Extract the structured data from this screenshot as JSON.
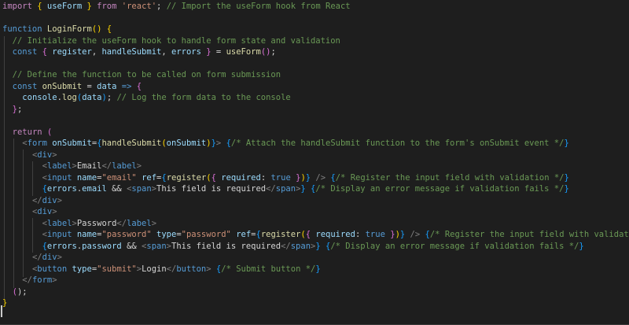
{
  "editor": {
    "colors": {
      "background": "#1e1e1e",
      "keyword": "#c586c0",
      "storage": "#569cd6",
      "variable": "#9cdcfe",
      "function": "#dcdcaa",
      "string": "#ce9178",
      "comment": "#6a9955",
      "tag": "#569cd6",
      "bracket_gold": "#ffd700",
      "bracket_pink": "#da70d6",
      "bracket_blue": "#179fff",
      "plain": "#d4d4d4"
    },
    "lines": [
      [
        [
          "import",
          "kw"
        ],
        [
          " ",
          "p"
        ],
        [
          "{",
          "y"
        ],
        [
          " useForm ",
          "v"
        ],
        [
          "}",
          "y"
        ],
        [
          " ",
          "p"
        ],
        [
          "from",
          "kw"
        ],
        [
          " ",
          "p"
        ],
        [
          "'react'",
          "s"
        ],
        [
          "; ",
          "p"
        ],
        [
          "// Import the useForm hook from React",
          "c"
        ]
      ],
      [],
      [
        [
          "function",
          "st"
        ],
        [
          " ",
          "p"
        ],
        [
          "LoginForm",
          "f"
        ],
        [
          "()",
          "y"
        ],
        [
          " ",
          "p"
        ],
        [
          "{",
          "y"
        ]
      ],
      [
        [
          "  ",
          "p"
        ],
        [
          "// Initialize the useForm hook to handle form state and validation",
          "c"
        ]
      ],
      [
        [
          "  ",
          "p"
        ],
        [
          "const",
          "st"
        ],
        [
          " ",
          "p"
        ],
        [
          "{",
          "pk"
        ],
        [
          " ",
          "p"
        ],
        [
          "register",
          "v"
        ],
        [
          ", ",
          "p"
        ],
        [
          "handleSubmit",
          "v"
        ],
        [
          ", ",
          "p"
        ],
        [
          "errors",
          "v"
        ],
        [
          " ",
          "p"
        ],
        [
          "}",
          "pk"
        ],
        [
          " = ",
          "p"
        ],
        [
          "useForm",
          "f"
        ],
        [
          "()",
          "pk"
        ],
        [
          ";",
          "p"
        ]
      ],
      [],
      [
        [
          "  ",
          "p"
        ],
        [
          "// Define the function to be called on form submission",
          "c"
        ]
      ],
      [
        [
          "  ",
          "p"
        ],
        [
          "const",
          "st"
        ],
        [
          " ",
          "p"
        ],
        [
          "onSubmit",
          "f"
        ],
        [
          " = ",
          "p"
        ],
        [
          "data",
          "v"
        ],
        [
          " ",
          "p"
        ],
        [
          "=>",
          "st"
        ],
        [
          " ",
          "p"
        ],
        [
          "{",
          "pk"
        ]
      ],
      [
        [
          "    ",
          "p"
        ],
        [
          "console",
          "v"
        ],
        [
          ".",
          "p"
        ],
        [
          "log",
          "f"
        ],
        [
          "(",
          "b"
        ],
        [
          "data",
          "v"
        ],
        [
          ")",
          "b"
        ],
        [
          "; ",
          "p"
        ],
        [
          "// Log the form data to the console",
          "c"
        ]
      ],
      [
        [
          "  ",
          "p"
        ],
        [
          "}",
          "pk"
        ],
        [
          ";",
          "p"
        ]
      ],
      [],
      [
        [
          "  ",
          "p"
        ],
        [
          "return",
          "kw"
        ],
        [
          " ",
          "p"
        ],
        [
          "(",
          "pk"
        ]
      ],
      [
        [
          "    ",
          "p"
        ],
        [
          "<",
          "g"
        ],
        [
          "form",
          "t"
        ],
        [
          " ",
          "p"
        ],
        [
          "onSubmit",
          "v"
        ],
        [
          "=",
          "p"
        ],
        [
          "{",
          "b"
        ],
        [
          "handleSubmit",
          "f"
        ],
        [
          "(",
          "y"
        ],
        [
          "onSubmit",
          "v"
        ],
        [
          ")",
          "y"
        ],
        [
          "}",
          "b"
        ],
        [
          ">",
          "g"
        ],
        [
          " ",
          "p"
        ],
        [
          "{",
          "b"
        ],
        [
          "/* Attach the handleSubmit function to the form's onSubmit event */",
          "c"
        ],
        [
          "}",
          "b"
        ]
      ],
      [
        [
          "      ",
          "p"
        ],
        [
          "<",
          "g"
        ],
        [
          "div",
          "t"
        ],
        [
          ">",
          "g"
        ]
      ],
      [
        [
          "        ",
          "p"
        ],
        [
          "<",
          "g"
        ],
        [
          "label",
          "t"
        ],
        [
          ">",
          "g"
        ],
        [
          "Email",
          "p"
        ],
        [
          "</",
          "g"
        ],
        [
          "label",
          "t"
        ],
        [
          ">",
          "g"
        ]
      ],
      [
        [
          "        ",
          "p"
        ],
        [
          "<",
          "g"
        ],
        [
          "input",
          "t"
        ],
        [
          " ",
          "p"
        ],
        [
          "name",
          "v"
        ],
        [
          "=",
          "p"
        ],
        [
          "\"email\"",
          "s"
        ],
        [
          " ",
          "p"
        ],
        [
          "ref",
          "v"
        ],
        [
          "=",
          "p"
        ],
        [
          "{",
          "b"
        ],
        [
          "register",
          "f"
        ],
        [
          "(",
          "y"
        ],
        [
          "{",
          "pk"
        ],
        [
          " ",
          "p"
        ],
        [
          "required",
          "v"
        ],
        [
          ": ",
          "p"
        ],
        [
          "true",
          "st"
        ],
        [
          " ",
          "p"
        ],
        [
          "}",
          "pk"
        ],
        [
          ")",
          "y"
        ],
        [
          "}",
          "b"
        ],
        [
          " ",
          "p"
        ],
        [
          "/>",
          "g"
        ],
        [
          " ",
          "p"
        ],
        [
          "{",
          "b"
        ],
        [
          "/* Register the input field with validation */",
          "c"
        ],
        [
          "}",
          "b"
        ]
      ],
      [
        [
          "        ",
          "p"
        ],
        [
          "{",
          "b"
        ],
        [
          "errors",
          "v"
        ],
        [
          ".",
          "p"
        ],
        [
          "email",
          "v"
        ],
        [
          " && ",
          "p"
        ],
        [
          "<",
          "g"
        ],
        [
          "span",
          "t"
        ],
        [
          ">",
          "g"
        ],
        [
          "This field is required",
          "p"
        ],
        [
          "</",
          "g"
        ],
        [
          "span",
          "t"
        ],
        [
          ">",
          "g"
        ],
        [
          "}",
          "b"
        ],
        [
          " ",
          "p"
        ],
        [
          "{",
          "b"
        ],
        [
          "/* Display an error message if validation fails */",
          "c"
        ],
        [
          "}",
          "b"
        ]
      ],
      [
        [
          "      ",
          "p"
        ],
        [
          "</",
          "g"
        ],
        [
          "div",
          "t"
        ],
        [
          ">",
          "g"
        ]
      ],
      [
        [
          "      ",
          "p"
        ],
        [
          "<",
          "g"
        ],
        [
          "div",
          "t"
        ],
        [
          ">",
          "g"
        ]
      ],
      [
        [
          "        ",
          "p"
        ],
        [
          "<",
          "g"
        ],
        [
          "label",
          "t"
        ],
        [
          ">",
          "g"
        ],
        [
          "Password",
          "p"
        ],
        [
          "</",
          "g"
        ],
        [
          "label",
          "t"
        ],
        [
          ">",
          "g"
        ]
      ],
      [
        [
          "        ",
          "p"
        ],
        [
          "<",
          "g"
        ],
        [
          "input",
          "t"
        ],
        [
          " ",
          "p"
        ],
        [
          "name",
          "v"
        ],
        [
          "=",
          "p"
        ],
        [
          "\"password\"",
          "s"
        ],
        [
          " ",
          "p"
        ],
        [
          "type",
          "v"
        ],
        [
          "=",
          "p"
        ],
        [
          "\"password\"",
          "s"
        ],
        [
          " ",
          "p"
        ],
        [
          "ref",
          "v"
        ],
        [
          "=",
          "p"
        ],
        [
          "{",
          "b"
        ],
        [
          "register",
          "f"
        ],
        [
          "(",
          "y"
        ],
        [
          "{",
          "pk"
        ],
        [
          " ",
          "p"
        ],
        [
          "required",
          "v"
        ],
        [
          ": ",
          "p"
        ],
        [
          "true",
          "st"
        ],
        [
          " ",
          "p"
        ],
        [
          "}",
          "pk"
        ],
        [
          ")",
          "y"
        ],
        [
          "}",
          "b"
        ],
        [
          " ",
          "p"
        ],
        [
          "/>",
          "g"
        ],
        [
          " ",
          "p"
        ],
        [
          "{",
          "b"
        ],
        [
          "/* Register the input field with validation */",
          "c"
        ],
        [
          "}",
          "b"
        ]
      ],
      [
        [
          "        ",
          "p"
        ],
        [
          "{",
          "b"
        ],
        [
          "errors",
          "v"
        ],
        [
          ".",
          "p"
        ],
        [
          "password",
          "v"
        ],
        [
          " && ",
          "p"
        ],
        [
          "<",
          "g"
        ],
        [
          "span",
          "t"
        ],
        [
          ">",
          "g"
        ],
        [
          "This field is required",
          "p"
        ],
        [
          "</",
          "g"
        ],
        [
          "span",
          "t"
        ],
        [
          ">",
          "g"
        ],
        [
          "}",
          "b"
        ],
        [
          " ",
          "p"
        ],
        [
          "{",
          "b"
        ],
        [
          "/* Display an error message if validation fails */",
          "c"
        ],
        [
          "}",
          "b"
        ]
      ],
      [
        [
          "      ",
          "p"
        ],
        [
          "</",
          "g"
        ],
        [
          "div",
          "t"
        ],
        [
          ">",
          "g"
        ]
      ],
      [
        [
          "      ",
          "p"
        ],
        [
          "<",
          "g"
        ],
        [
          "button",
          "t"
        ],
        [
          " ",
          "p"
        ],
        [
          "type",
          "v"
        ],
        [
          "=",
          "p"
        ],
        [
          "\"submit\"",
          "s"
        ],
        [
          ">",
          "g"
        ],
        [
          "Login",
          "p"
        ],
        [
          "</",
          "g"
        ],
        [
          "button",
          "t"
        ],
        [
          ">",
          "g"
        ],
        [
          " ",
          "p"
        ],
        [
          "{",
          "b"
        ],
        [
          "/* Submit button */",
          "c"
        ],
        [
          "}",
          "b"
        ]
      ],
      [
        [
          "    ",
          "p"
        ],
        [
          "</",
          "g"
        ],
        [
          "form",
          "t"
        ],
        [
          ">",
          "g"
        ]
      ],
      [
        [
          "  ",
          "p"
        ],
        [
          "(",
          "pk"
        ],
        [
          ");",
          "p"
        ]
      ],
      [
        [
          "}",
          "y"
        ]
      ]
    ]
  }
}
